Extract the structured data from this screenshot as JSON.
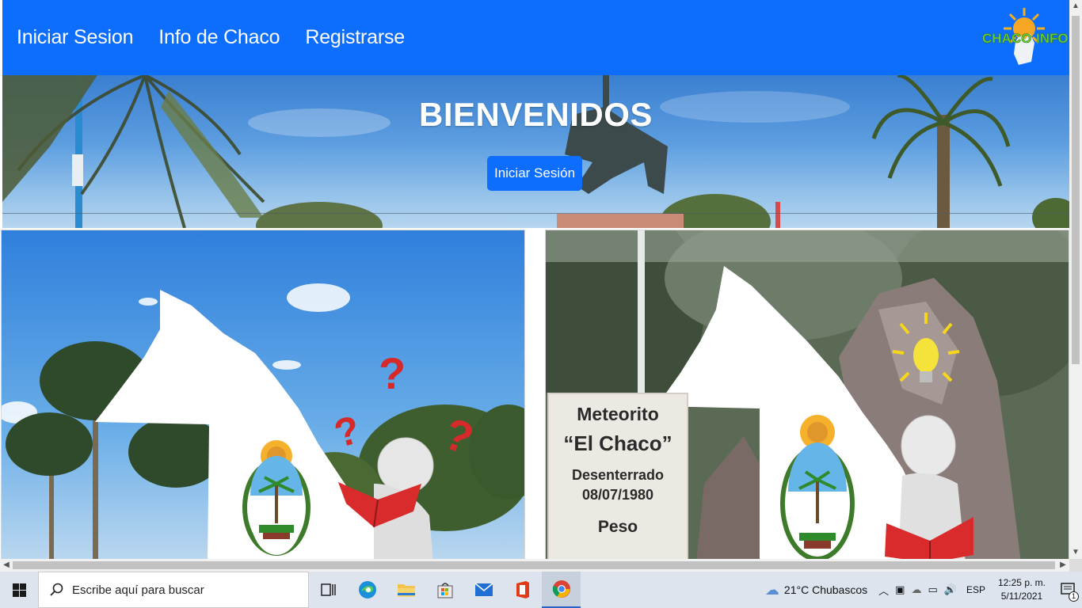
{
  "nav": {
    "links": [
      "Iniciar Sesion",
      "Info de Chaco",
      "Registrarse"
    ],
    "logo_text_left": "CHACO",
    "logo_text_right": "INFO"
  },
  "hero": {
    "title": "BIENVENIDOS",
    "button_label": "Iniciar Sesión"
  },
  "card_right": {
    "sign_lines": [
      "Meteorito",
      "“El Chaco”",
      "Desenterrado",
      "08/07/1980",
      "Peso"
    ]
  },
  "taskbar": {
    "search_placeholder": "Escribe aquí para buscar",
    "weather": "21°C  Chubascos",
    "language": "ESP",
    "time": "12:25 p. m.",
    "date": "5/11/2021",
    "notification_count": "1",
    "pinned_apps": [
      "task-view",
      "edge",
      "file-explorer",
      "microsoft-store",
      "mail",
      "office",
      "chrome"
    ]
  },
  "colors": {
    "primary": "#0d6efd",
    "taskbar": "#dde4ee"
  }
}
